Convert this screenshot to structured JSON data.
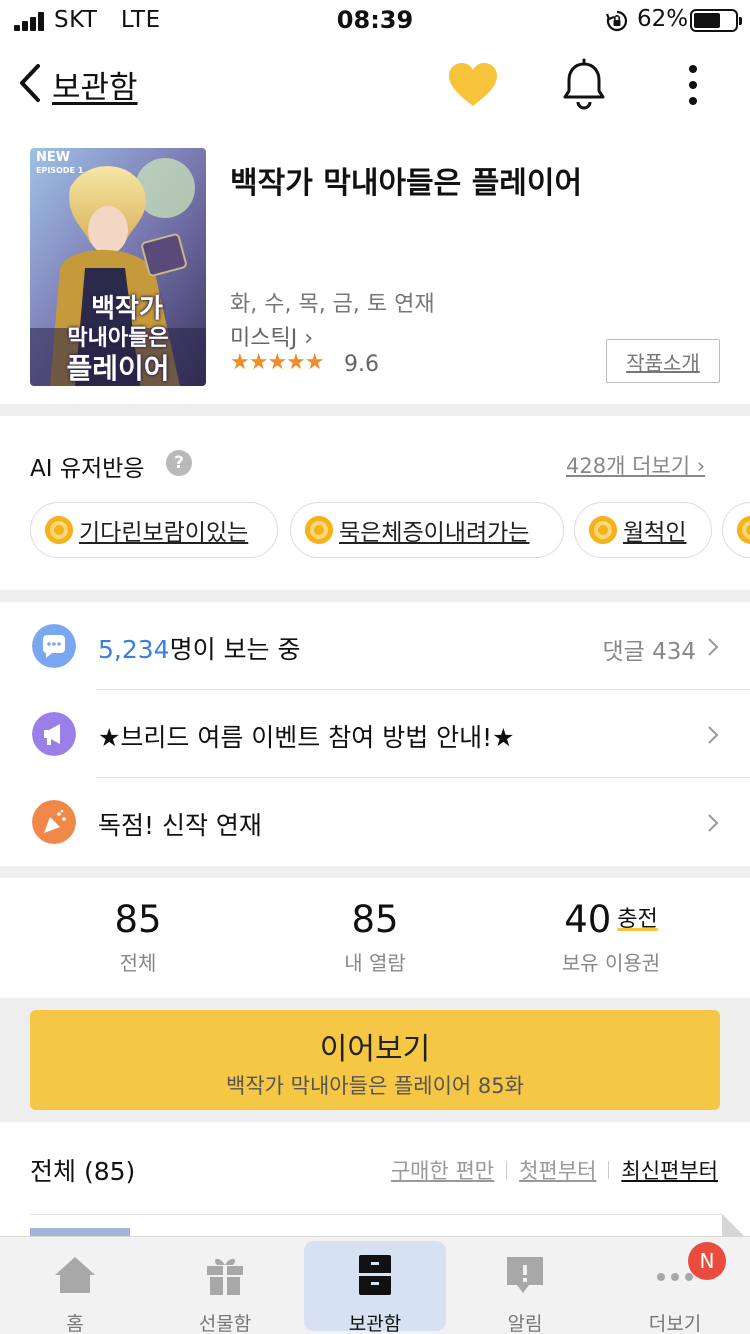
{
  "status_bar": {
    "carrier": "SKT   LTE",
    "time": "08:39",
    "battery": "62%",
    "battery_level": 0.62
  },
  "header": {
    "back_label": "보관함",
    "icons": [
      "chevron-left-icon",
      "heart-icon",
      "bell-icon",
      "more-vertical-icon"
    ],
    "heart_color": "#f5c43a"
  },
  "book": {
    "title": "백작가 막내아들은 플레이어",
    "schedule": "화, 수, 목, 금, 토 연재",
    "author": "미스틱J ›",
    "stars": "★★★★★",
    "rating": "9.6",
    "intro_button": "작품소개",
    "cover_art": {
      "badge_new": "NEW",
      "badge_episode": "EPISODE 1",
      "line1": "백작가",
      "line2": "막내아들은",
      "line3": "플레이어"
    }
  },
  "ai_reactions": {
    "title": "AI 유저반응",
    "help": "?",
    "more": "428개 더보기 ›",
    "chips": [
      "기다린보람이있는",
      "묵은체증이내려가는",
      "월척인"
    ]
  },
  "info_rows": {
    "viewers_count": "5,234",
    "viewers_suffix": "명이 보는 중",
    "comments": "댓글 434",
    "event": "★브리드 여름 이벤트 참여 방법 안내!★",
    "exclusive": "독점! 신작 연재"
  },
  "stats": {
    "total_value": "85",
    "total_label": "전체",
    "read_value": "85",
    "read_label": "내 열람",
    "ticket_value": "40",
    "ticket_charge": "충전",
    "ticket_label": "보유 이용권"
  },
  "continue": {
    "title": "이어보기",
    "subtitle": "백작가 막내아들은 플레이어 85화"
  },
  "episode_list": {
    "title": "전체 (85)",
    "filters": [
      "구매한 편만",
      "첫편부터",
      "최신편부터"
    ],
    "active_filter": "최신편부터"
  },
  "tabbar": {
    "tabs": [
      {
        "label": "홈",
        "icon": "home-icon"
      },
      {
        "label": "선물함",
        "icon": "gift-icon"
      },
      {
        "label": "보관함",
        "icon": "locker-icon"
      },
      {
        "label": "알림",
        "icon": "notification-icon"
      },
      {
        "label": "더보기",
        "icon": "more-horizontal-icon"
      }
    ],
    "active": "보관함",
    "badge": "N"
  },
  "colors": {
    "accent_yellow": "#f6c745",
    "blue": "#3a7fe0",
    "star_orange": "#f08c2a",
    "badge_red": "#e94b3c"
  }
}
